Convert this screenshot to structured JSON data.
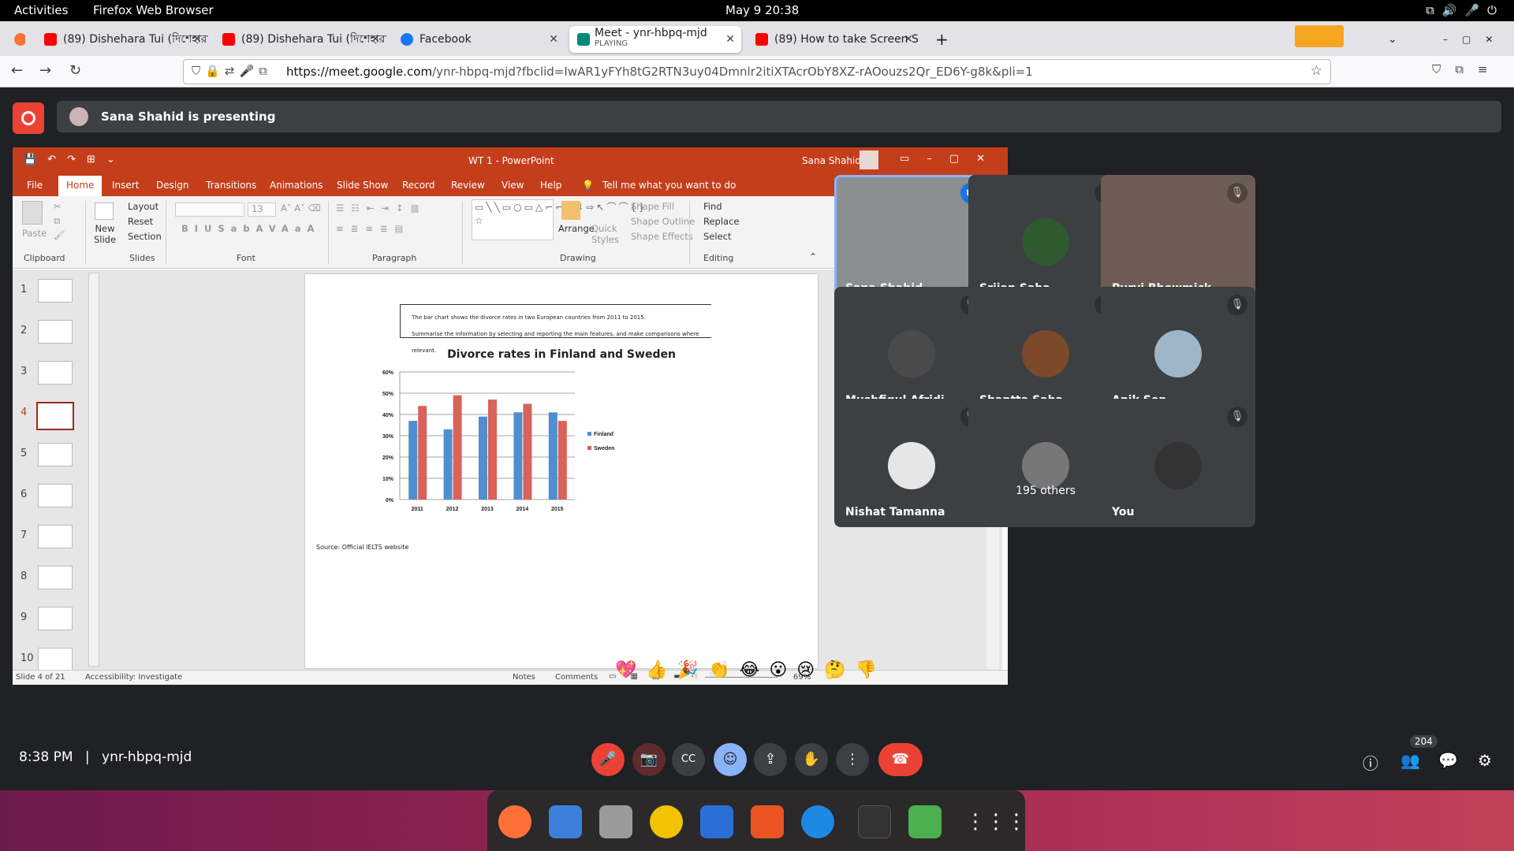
{
  "gnome": {
    "activities": "Activities",
    "app": "Firefox Web Browser",
    "clock": "May 9  20:38"
  },
  "browser": {
    "tabs": [
      {
        "title": "(89) Dishehara Tui (দিশেহারা",
        "color": "#ff0000"
      },
      {
        "title": "(89) Dishehara Tui (দিশেহারা",
        "color": "#ff0000"
      },
      {
        "title": "Facebook",
        "color": "#1877f2"
      },
      {
        "title": "Meet - ynr-hbpq-mjd",
        "sub": "PLAYING",
        "color": "#00897b"
      },
      {
        "title": "(89) How to take Screen S",
        "color": "#ff0000"
      }
    ],
    "url_host": "https://meet.google.com",
    "url_rest": "/ynr-hbpq-mjd?fbclid=IwAR1yFYh8tG2RTN3uy04Dmnlr2itiXTAcrObY8XZ-rAOouzs2Qr_ED6Y-g8k&pli=1"
  },
  "meet": {
    "presenting": "Sana Shahid is presenting",
    "time": "8:38 PM",
    "separator": "|",
    "code": "ynr-hbpq-mjd",
    "participant_count": "204",
    "participants": [
      {
        "name": "Sana Shahid",
        "speaking": true
      },
      {
        "name": "Srijan Saha"
      },
      {
        "name": "Purvi Bhowmick"
      },
      {
        "name": "Mushfiqul Afridi"
      },
      {
        "name": "Shantta Saha"
      },
      {
        "name": "Anik Sen"
      },
      {
        "name": "Nishat Tamanna"
      },
      {
        "name": "195 others"
      },
      {
        "name": "You"
      }
    ],
    "reactions": [
      "💖",
      "👍",
      "🎉",
      "👏",
      "😂",
      "😮",
      "😢",
      "🤔",
      "👎"
    ]
  },
  "ppt": {
    "title": "WT 1  -  PowerPoint",
    "user": "Sana Shahid",
    "tabs": [
      "File",
      "Home",
      "Insert",
      "Design",
      "Transitions",
      "Animations",
      "Slide Show",
      "Record",
      "Review",
      "View",
      "Help",
      "Tell me what you want to do"
    ],
    "ribbon": {
      "paste": "Paste",
      "clipboard": "Clipboard",
      "new_slide": "New Slide",
      "layout": "Layout",
      "reset": "Reset",
      "section": "Section",
      "slides": "Slides",
      "font_size": "13",
      "font": "Font",
      "paragraph": "Paragraph",
      "arrange": "Arrange",
      "quick_styles": "Quick Styles",
      "shape_fill": "Shape Fill",
      "shape_outline": "Shape Outline",
      "shape_effects": "Shape Effects",
      "drawing": "Drawing",
      "find": "Find",
      "replace": "Replace",
      "select": "Select",
      "editing": "Editing"
    },
    "slide_numbers": [
      "1",
      "2",
      "3",
      "4",
      "5",
      "6",
      "7",
      "8",
      "9",
      "10"
    ],
    "selected_slide": "4",
    "task_line1": "The bar chart shows the divorce rates in two European countries from 2011 to 2015.",
    "task_line2": "Summarise the information by selecting and reporting the main features, and make comparisons where relevant.",
    "source": "Source: Official IELTS website",
    "status": {
      "slide": "Slide 4 of 21",
      "accessibility": "Accessibility: Investigate",
      "notes": "Notes",
      "comments": "Comments",
      "zoom": "69%"
    }
  },
  "chart_data": {
    "type": "bar",
    "title": "Divorce rates in Finland and Sweden",
    "categories": [
      "2011",
      "2012",
      "2013",
      "2014",
      "2015"
    ],
    "series": [
      {
        "name": "Finland",
        "values": [
          37,
          33,
          39,
          41,
          41
        ],
        "color": "#4f8fd0"
      },
      {
        "name": "Sweden",
        "values": [
          44,
          49,
          47,
          45,
          37
        ],
        "color": "#d9625a"
      }
    ],
    "yticks": [
      "0%",
      "10%",
      "20%",
      "30%",
      "40%",
      "50%",
      "60%"
    ],
    "ylim": [
      0,
      60
    ],
    "grid": true,
    "legend": "right"
  }
}
